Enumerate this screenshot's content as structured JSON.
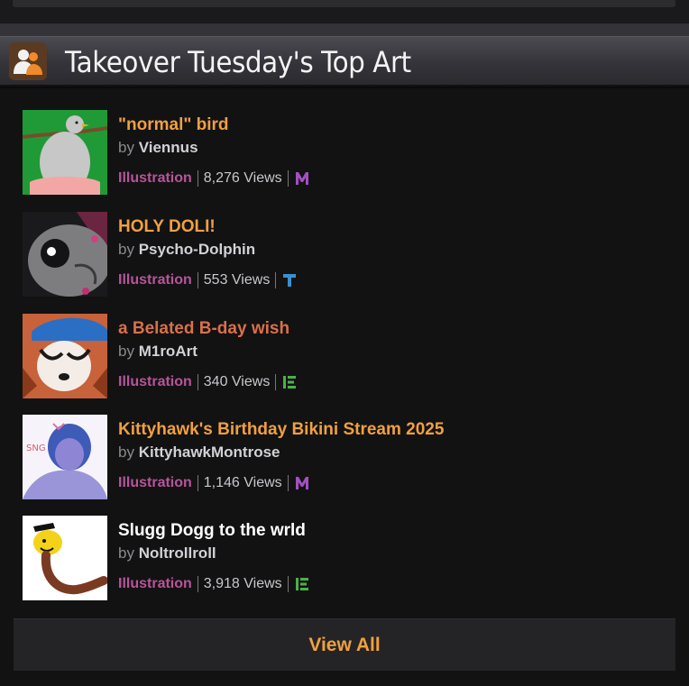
{
  "header": {
    "title": "Takeover Tuesday's Top Art",
    "icon": "users-icon"
  },
  "items": [
    {
      "title": "\"normal\" bird",
      "title_color": "#f0a040",
      "by": "by",
      "author": "Viennus",
      "category": "Illustration",
      "views": "8,276 Views",
      "rating": "M",
      "rating_color": "#a24fc1"
    },
    {
      "title": "HOLY DOLI!",
      "title_color": "#f0a040",
      "by": "by",
      "author": "Psycho-Dolphin",
      "category": "Illustration",
      "views": "553 Views",
      "rating": "T",
      "rating_color": "#3a8fd1"
    },
    {
      "title": "a Belated B-day wish",
      "title_color": "#d9704a",
      "by": "by",
      "author": "M1roArt",
      "category": "Illustration",
      "views": "340 Views",
      "rating": "E",
      "rating_color": "#4bb04b"
    },
    {
      "title": "Kittyhawk's Birthday Bikini Stream 2025",
      "title_color": "#f0a040",
      "by": "by",
      "author": "KittyhawkMontrose",
      "category": "Illustration",
      "views": "1,146 Views",
      "rating": "M",
      "rating_color": "#a24fc1"
    },
    {
      "title": "Slugg Dogg to the wrld",
      "title_color": "#ffffff",
      "by": "by",
      "author": "Noltrollroll",
      "category": "Illustration",
      "views": "3,918 Views",
      "rating": "E",
      "rating_color": "#4bb04b"
    }
  ],
  "view_all": {
    "label": "View All",
    "color": "#f0a040"
  }
}
